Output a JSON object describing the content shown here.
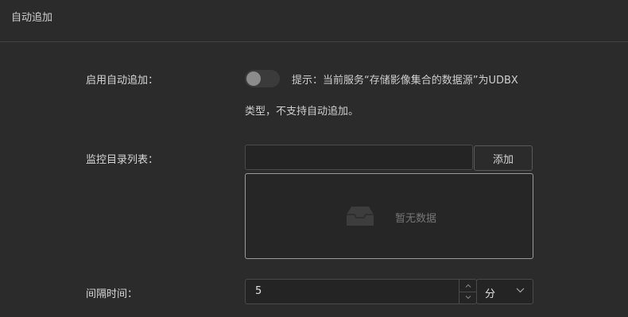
{
  "header": {
    "title": "自动追加"
  },
  "auto_append": {
    "label": "启用自动追加：",
    "enabled": false,
    "hint_line1": "提示：当前服务“存储影像集合的数据源”为UDBX",
    "hint_line2": "类型，不支持自动追加。"
  },
  "monitor_dirs": {
    "label": "监控目录列表：",
    "input_value": "",
    "add_button": "添加",
    "empty_text": "暂无数据"
  },
  "interval": {
    "label": "间隔时间：",
    "value": "5",
    "unit": "分"
  }
}
